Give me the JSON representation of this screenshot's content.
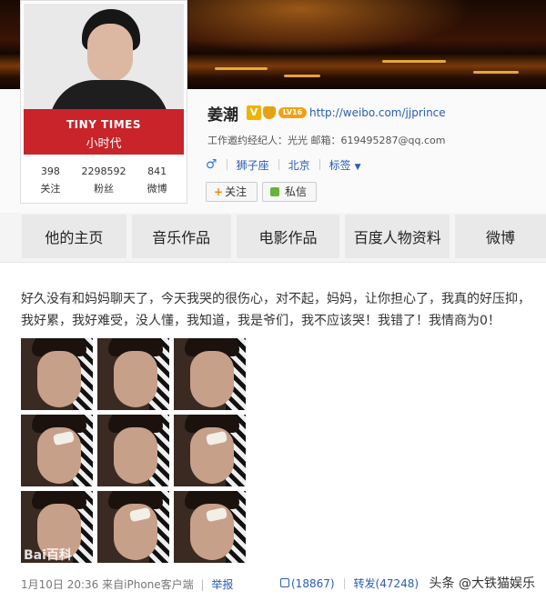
{
  "avatar": {
    "brand_line1": "TINY TIMES",
    "brand_line2": "小时代"
  },
  "stats": [
    {
      "num": "398",
      "label": "关注"
    },
    {
      "num": "2298592",
      "label": "粉丝"
    },
    {
      "num": "841",
      "label": "微博"
    }
  ],
  "profile": {
    "name": "姜潮",
    "verified_badge": "V",
    "level": "LV16",
    "home_url": "http://weibo.com/jjprince",
    "agent_info": "工作邀约经纪人：光光 邮箱：619495287@qq.com",
    "gender_icon": "♂",
    "zodiac": "狮子座",
    "city": "北京",
    "tags_label": "标签",
    "follow_label": "关注",
    "message_label": "私信"
  },
  "tabs": [
    "他的主页",
    "音乐作品",
    "电影作品",
    "百度人物资料",
    "微博"
  ],
  "post": {
    "text": "好久没有和妈妈聊天了，今天我哭的很伤心，对不起，妈妈，让你担心了，我真的好压抑，我好累，我好难受，没人懂，我知道，我是爷们，我不应该哭！我错了！我情商为0！",
    "watermark": "Bai百科",
    "date": "1月10日 20:36",
    "source": "来自iPhone客户端",
    "report": "举报",
    "likes": "(18867)",
    "repost_label": "转发(47248)",
    "credit": "头条 @大铁猫娱乐"
  },
  "colors": {
    "brand_red": "#c8242a",
    "link_blue": "#2a5db0",
    "badge_gold": "#f0b400"
  }
}
